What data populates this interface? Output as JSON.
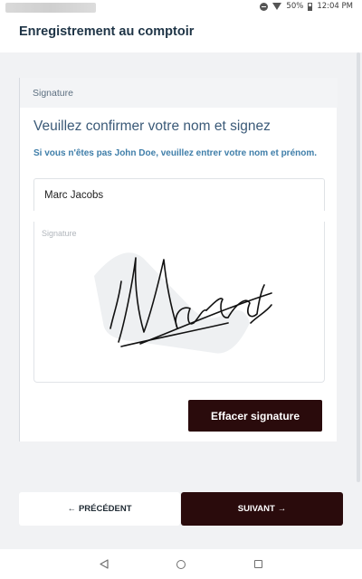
{
  "status_bar": {
    "battery": "50%",
    "time": "12:04 PM"
  },
  "app": {
    "title": "Enregistrement au comptoir"
  },
  "card": {
    "section_label": "Signature",
    "title": "Veuillez confirmer votre nom et signez",
    "instructions": "Si vous n'êtes pas John Doe, veuillez entrer votre nom et prénom.",
    "name_value": "Marc Jacobs",
    "signature_label": "Signature",
    "signature_text": "Marc",
    "clear_button": "Effacer signature"
  },
  "footer": {
    "prev_label": "PRÉCÉDENT",
    "next_label": "SUIVANT"
  },
  "colors": {
    "brand_dark": "#2a0b0c",
    "title_blue": "#3b5a78",
    "instruction_blue": "#3f7ea9"
  }
}
